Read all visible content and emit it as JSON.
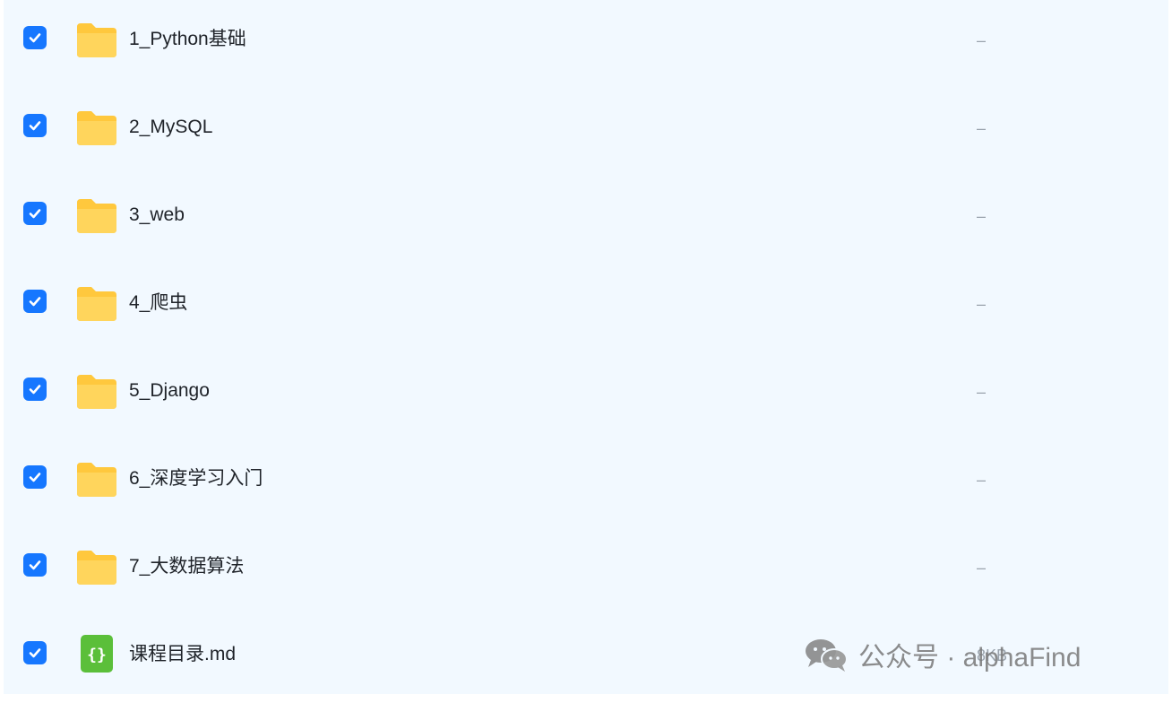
{
  "files": [
    {
      "name": "1_Python基础",
      "size": "–",
      "type": "folder",
      "checked": true
    },
    {
      "name": "2_MySQL",
      "size": "–",
      "type": "folder",
      "checked": true
    },
    {
      "name": "3_web",
      "size": "–",
      "type": "folder",
      "checked": true
    },
    {
      "name": "4_爬虫",
      "size": "–",
      "type": "folder",
      "checked": true
    },
    {
      "name": "5_Django",
      "size": "–",
      "type": "folder",
      "checked": true
    },
    {
      "name": "6_深度学习入门",
      "size": "–",
      "type": "folder",
      "checked": true
    },
    {
      "name": "7_大数据算法",
      "size": "–",
      "type": "folder",
      "checked": true
    },
    {
      "name": "课程目录.md",
      "size": "8KB",
      "type": "code-file",
      "checked": true
    }
  ],
  "watermark": {
    "account": "公众号 · alphaFind",
    "icon": "wechat-icon"
  },
  "colors": {
    "panel_bg": "#f2f9ff",
    "checkbox": "#1677ff",
    "folder": "#ffc83d",
    "code_file": "#5bbf3a"
  }
}
